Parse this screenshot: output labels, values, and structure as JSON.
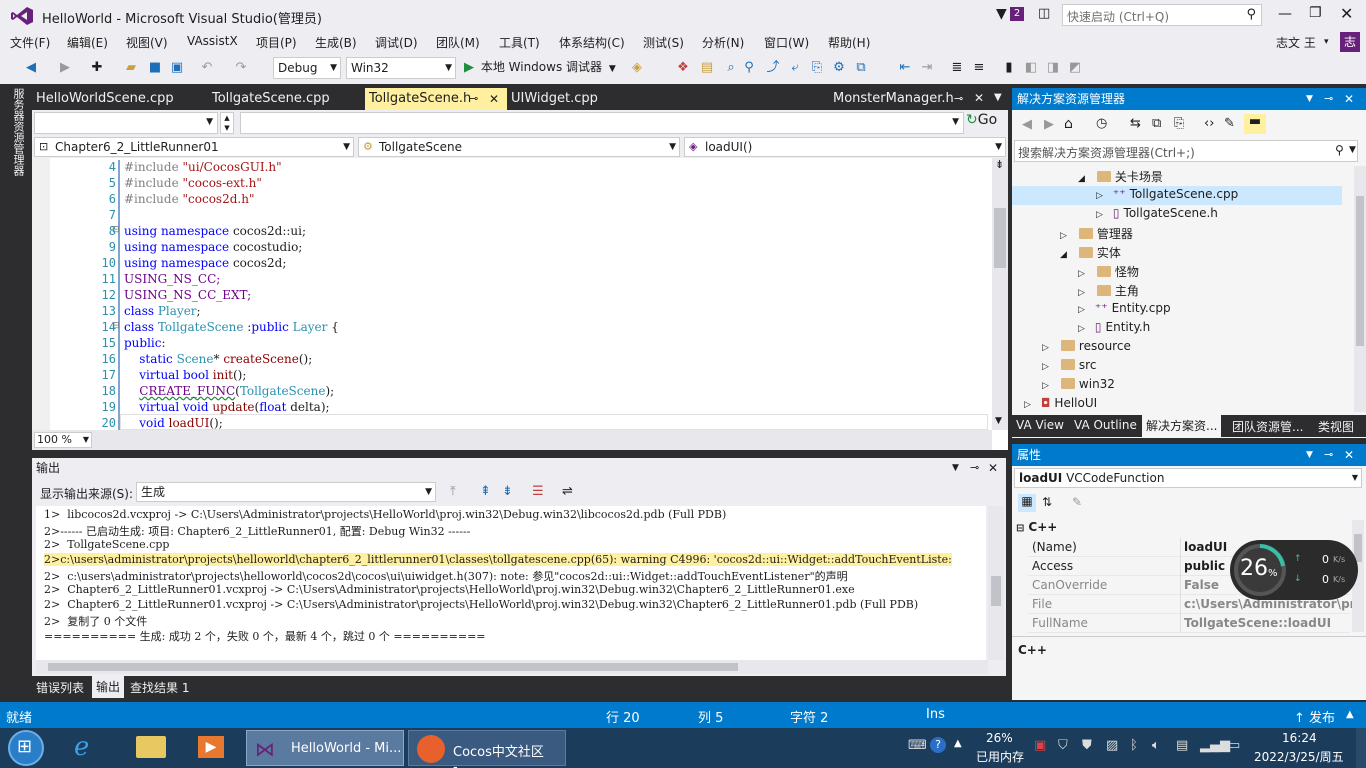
{
  "window": {
    "title": "HelloWorld - Microsoft Visual Studio(管理员)",
    "notify_count": "2",
    "quick_launch_placeholder": "快速启动 (Ctrl+Q)",
    "user": "志文 王",
    "avatar": "志"
  },
  "menu": [
    "文件(F)",
    "编辑(E)",
    "视图(V)",
    "VAssistX",
    "项目(P)",
    "生成(B)",
    "调试(D)",
    "团队(M)",
    "工具(T)",
    "体系结构(C)",
    "测试(S)",
    "分析(N)",
    "窗口(W)",
    "帮助(H)"
  ],
  "toolbar": {
    "config": "Debug",
    "platform": "Win32",
    "run_label": "本地 Windows 调试器"
  },
  "left_strip": {
    "label": "服务器资源管理器"
  },
  "doc_tabs": [
    {
      "label": "HelloWorldScene.cpp"
    },
    {
      "label": "TollgateScene.cpp"
    },
    {
      "label": "TollgateScene.h"
    },
    {
      "label": "UIWidget.cpp"
    },
    {
      "label": "MonsterManager.h"
    }
  ],
  "va": {
    "go_label": "Go"
  },
  "nav": {
    "project": "Chapter6_2_LittleRunner01",
    "class": "TollgateScene",
    "member": "loadUI()"
  },
  "code": {
    "line_numbers": [
      "4",
      "5",
      "6",
      "7",
      "8",
      "9",
      "10",
      "11",
      "12",
      "13",
      "14",
      "15",
      "16",
      "17",
      "18",
      "19",
      "20"
    ],
    "zoom": "100 %"
  },
  "output": {
    "title": "输出",
    "source_label": "显示输出来源(S):",
    "source_value": "生成",
    "lines": [
      "1>  libcocos2d.vcxproj -> C:\\Users\\Administrator\\projects\\HelloWorld\\proj.win32\\Debug.win32\\libcocos2d.pdb (Full PDB)",
      "2>------ 已启动生成: 项目: Chapter6_2_LittleRunner01, 配置: Debug Win32 ------",
      "2>  TollgateScene.cpp",
      "2>c:\\users\\administrator\\projects\\helloworld\\chapter6_2_littlerunner01\\classes\\tollgatescene.cpp(65): warning C4996: 'cocos2d::ui::Widget::addTouchEventListe:",
      "2>  c:\\users\\administrator\\projects\\helloworld\\cocos2d\\cocos\\ui\\uiwidget.h(307): note: 参见\"cocos2d::ui::Widget::addTouchEventListener\"的声明",
      "2>  Chapter6_2_LittleRunner01.vcxproj -> C:\\Users\\Administrator\\projects\\HelloWorld\\proj.win32\\Debug.win32\\Chapter6_2_LittleRunner01.exe",
      "2>  Chapter6_2_LittleRunner01.vcxproj -> C:\\Users\\Administrator\\projects\\HelloWorld\\proj.win32\\Debug.win32\\Chapter6_2_LittleRunner01.pdb (Full PDB)",
      "2>  复制了 0 个文件",
      "========== 生成: 成功 2 个，失败 0 个，最新 4 个，跳过 0 个 =========="
    ],
    "bottom_tabs": [
      "错误列表",
      "输出",
      "查找结果 1"
    ]
  },
  "solution_explorer": {
    "title": "解决方案资源管理器",
    "search_placeholder": "搜索解决方案资源管理器(Ctrl+;)",
    "items": [
      {
        "label": "关卡场景",
        "kind": "folder"
      },
      {
        "label": "TollgateScene.cpp",
        "kind": "cpp"
      },
      {
        "label": "TollgateScene.h",
        "kind": "h"
      },
      {
        "label": "管理器",
        "kind": "folder"
      },
      {
        "label": "实体",
        "kind": "folder"
      },
      {
        "label": "怪物",
        "kind": "folder"
      },
      {
        "label": "主角",
        "kind": "folder"
      },
      {
        "label": "Entity.cpp",
        "kind": "cpp"
      },
      {
        "label": "Entity.h",
        "kind": "h"
      },
      {
        "label": "resource",
        "kind": "folder"
      },
      {
        "label": "src",
        "kind": "folder"
      },
      {
        "label": "win32",
        "kind": "folder"
      },
      {
        "label": "HelloUI",
        "kind": "project"
      }
    ],
    "bottom_tabs": [
      "VA View",
      "VA Outline",
      "解决方案资...",
      "团队资源管...",
      "类视图"
    ]
  },
  "properties": {
    "title": "属性",
    "object_name": "loadUI",
    "object_type": "VCCodeFunction",
    "category": "C++",
    "rows": [
      {
        "name": "(Name)",
        "value": "loadUI"
      },
      {
        "name": "Access",
        "value": "public"
      },
      {
        "name": "CanOverride",
        "value": "False"
      },
      {
        "name": "File",
        "value": "c:\\Users\\Administrator\\pr"
      },
      {
        "name": "FullName",
        "value": "TollgateScene::loadUI"
      }
    ],
    "description": "C++",
    "net_gauge": {
      "percent": "26",
      "unit": "%",
      "up": "0",
      "down": "0",
      "rate_unit": "K/s"
    }
  },
  "status": {
    "ready": "就绪",
    "line": "行 20",
    "col": "列 5",
    "ch": "字符 2",
    "mode": "Ins",
    "publish": "发布"
  },
  "taskbar": {
    "apps": [
      {
        "label": "HelloWorld - Mi..."
      },
      {
        "label": "Cocos中文社区 -..."
      }
    ],
    "mem_percent": "26%",
    "mem_label": "已用内存",
    "time": "16:24",
    "date": "2022/3/25/周五"
  },
  "colors": {
    "accent": "#007acc",
    "vs_purple": "#68217a",
    "active_tab": "#fff0a0"
  }
}
